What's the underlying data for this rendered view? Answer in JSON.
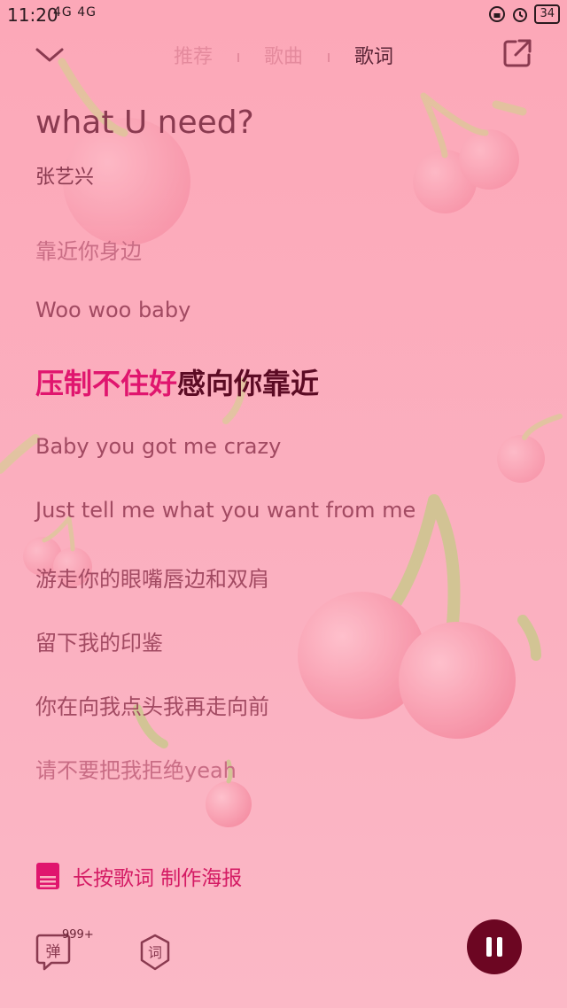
{
  "status_bar": {
    "time": "11:20",
    "network": "4G 4G",
    "battery": "34"
  },
  "tabs": [
    {
      "label": "推荐",
      "active": false
    },
    {
      "label": "歌曲",
      "active": false
    },
    {
      "label": "歌词",
      "active": true
    }
  ],
  "song": {
    "title": "what U need?",
    "artist": "张艺兴"
  },
  "lyrics": {
    "prev_2": "靠近你身边",
    "prev_1": "Woo woo baby",
    "current_sung": "压制不住好",
    "current_rest": "感向你靠近",
    "next_1": "Baby you got me crazy",
    "next_2": "Just tell me what you want from me",
    "next_3": "游走你的眼嘴唇边和双肩",
    "next_4": "留下我的印鉴",
    "next_5": "你在向我点头我再走向前",
    "next_6": "请不要把我拒绝yeah"
  },
  "poster": {
    "label": "长按歌词 制作海报"
  },
  "controls": {
    "danmaku_label": "弹",
    "danmaku_count": "999+",
    "lyric_label": "词"
  },
  "colors": {
    "accent": "#e0156e",
    "current_line": "#5c0b24",
    "lyric_text": "#a24a62",
    "play_button": "#6c0622"
  },
  "icons": [
    "collapse-chevron-icon",
    "share-icon",
    "poster-icon",
    "danmaku-icon",
    "lyric-icon",
    "pause-icon"
  ]
}
